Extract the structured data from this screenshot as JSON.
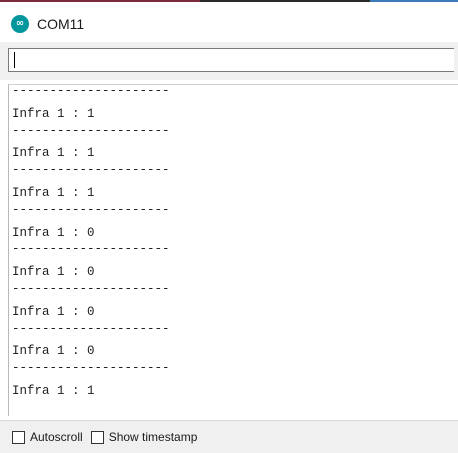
{
  "window": {
    "title": "COM11",
    "icon": "arduino-infinity-icon",
    "accent_color": "#00979c"
  },
  "send_bar": {
    "input_value": ""
  },
  "output": {
    "lines": [
      "---------------------",
      "Infra 1 : 1",
      "---------------------",
      "Infra 1 : 1",
      "---------------------",
      "Infra 1 : 1",
      "---------------------",
      "Infra 1 : 0",
      "---------------------",
      "Infra 1 : 0",
      "---------------------",
      "Infra 1 : 0",
      "---------------------",
      "Infra 1 : 0",
      "---------------------",
      "Infra 1 : 1"
    ]
  },
  "footer": {
    "autoscroll_label": "Autoscroll",
    "autoscroll_checked": false,
    "timestamp_label": "Show timestamp",
    "timestamp_checked": false
  }
}
